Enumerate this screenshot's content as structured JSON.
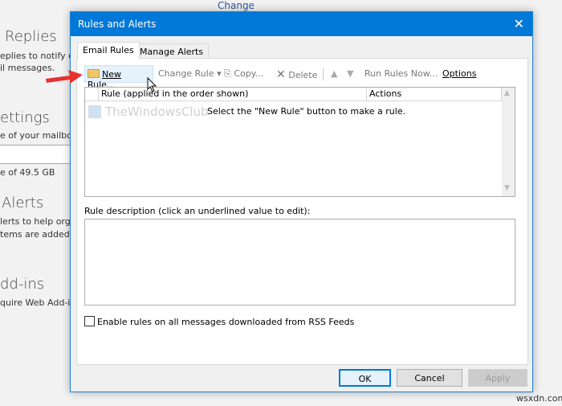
{
  "background": {
    "link": "Change",
    "sections": [
      {
        "heading": "Replies",
        "lines": [
          "eplies to notify o",
          "il messages."
        ]
      },
      {
        "heading": "ettings",
        "lines": [
          "e of your mailbox",
          "",
          "e of 49.5 GB"
        ]
      },
      {
        "heading": "Alerts",
        "lines": [
          "lerts to help orga",
          "tems are added, o"
        ]
      },
      {
        "heading": "dd-ins",
        "lines": [
          "quire Web Add-ir"
        ]
      }
    ]
  },
  "dialog": {
    "title": "Rules and Alerts",
    "close_icon": "close-icon",
    "tabs": [
      {
        "label": "Email Rules",
        "active": true
      },
      {
        "label": "Manage Alerts",
        "active": false
      }
    ],
    "toolbar": {
      "new_rule": "New Rule...",
      "change_rule": "Change Rule",
      "copy": "Copy...",
      "delete": "Delete",
      "run_rules_now": "Run Rules Now...",
      "options": "Options"
    },
    "list": {
      "columns": [
        "Rule (applied in the order shown)",
        "Actions"
      ],
      "empty_message": "Select the \"New Rule\" button to make a rule.",
      "watermark": "TheWindowsClub"
    },
    "description_label": "Rule description (click an underlined value to edit):",
    "rss_checkbox": {
      "label": "Enable rules on all messages downloaded from RSS Feeds",
      "checked": false
    },
    "buttons": {
      "ok": "OK",
      "cancel": "Cancel",
      "apply": "Apply"
    },
    "accent": "#0078d7"
  },
  "watermark": "wsxdn.com"
}
